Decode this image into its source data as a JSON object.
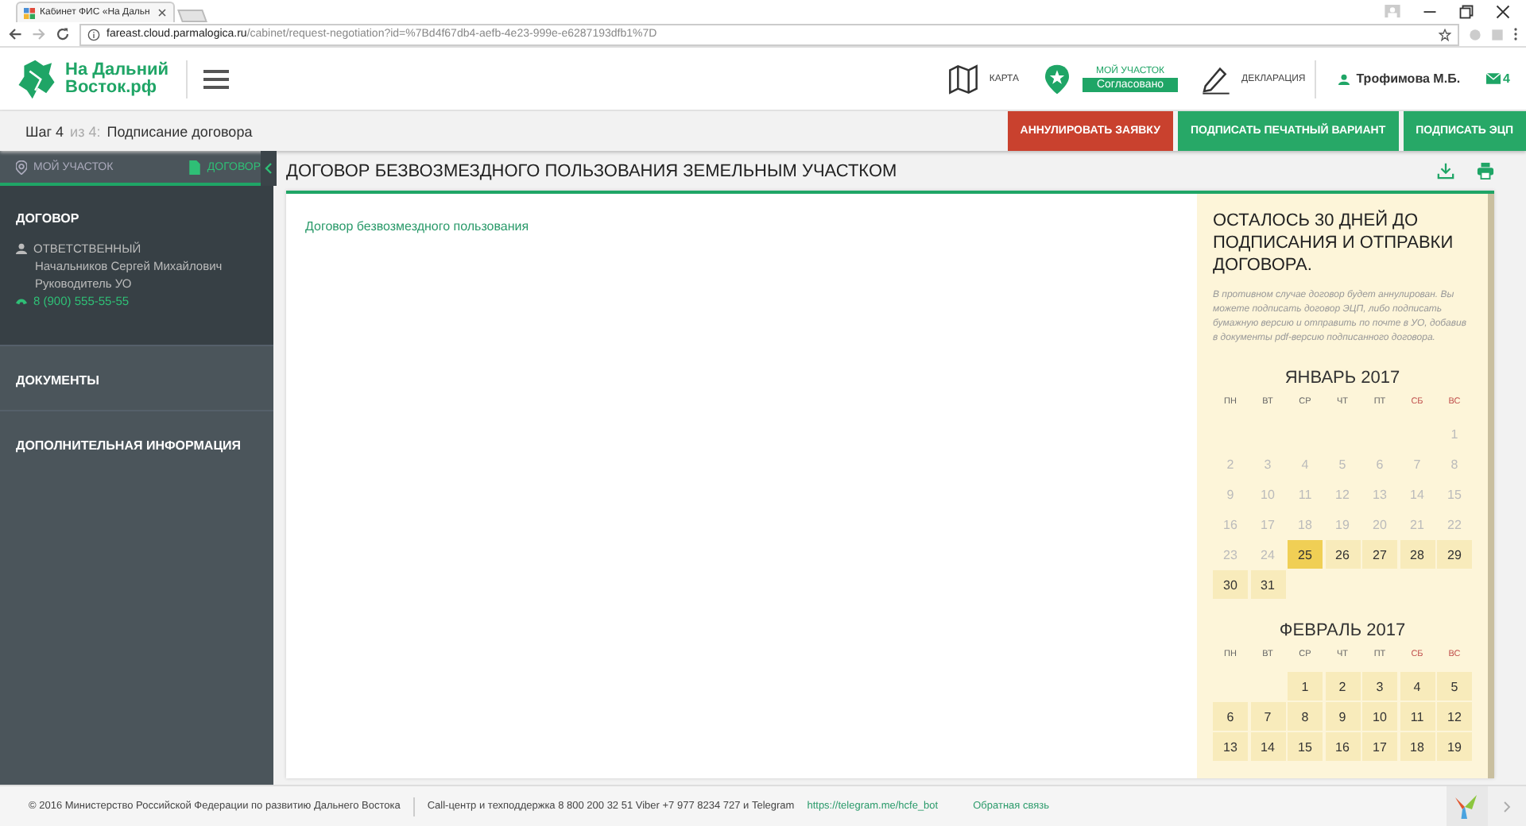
{
  "browser": {
    "tab_title": "Кабинет ФИС «На Дальн",
    "url_host": "fareast.cloud.parmalogica.ru",
    "url_path": "/cabinet/request-negotiation?id=%7Bd4f67db4-aefb-4e23-999e-e6287193dfb1%7D"
  },
  "header": {
    "logo_text": "На Дальний Восток.рф",
    "nav": [
      {
        "kind": "map",
        "label": "КАРТА"
      },
      {
        "kind": "plot",
        "label": "МОЙ УЧАСТОК",
        "badge": "Согласовано"
      },
      {
        "kind": "declaration",
        "label": "ДЕКЛАРАЦИЯ"
      }
    ],
    "user": "Трофимова М.Б.",
    "messages": "4"
  },
  "step": {
    "current": "Шаг 4",
    "of": "из 4:",
    "title": "Подписание договора"
  },
  "actions": [
    {
      "kind": "danger",
      "label": "АННУЛИРОВАТЬ ЗАЯВКУ"
    },
    {
      "kind": "primary",
      "label": "ПОДПИСАТЬ ПЕЧАТНЫЙ ВАРИАНТ"
    },
    {
      "kind": "primary",
      "label": "ПОДПИСАТЬ ЭЦП"
    }
  ],
  "sidebar": {
    "tabs": [
      {
        "kind": "plot",
        "label": "МОЙ УЧАСТОК",
        "selected": false
      },
      {
        "kind": "document",
        "label": "ДОГОВОР",
        "selected": true
      }
    ],
    "sections": [
      {
        "title": "ДОГОВОР",
        "expanded": true,
        "responsible_label": "ОТВЕТСТВЕННЫЙ",
        "person": "Начальников Сергей Михайлович",
        "role": "Руководитель УО",
        "phone": "8 (900) 555-55-55"
      },
      {
        "title": "ДОКУМЕНТЫ",
        "expanded": false
      },
      {
        "title": "ДОПОЛНИТЕЛЬНАЯ ИНФОРМАЦИЯ",
        "expanded": false
      }
    ]
  },
  "document": {
    "title": "ДОГОВОР БЕЗВОЗМЕЗДНОГО ПОЛЬЗОВАНИЯ ЗЕМЕЛЬНЫМ УЧАСТКОМ",
    "link": "Договор безвозмездного пользования"
  },
  "deadline": {
    "heading": "ОСТАЛОСЬ 30 ДНЕЙ ДО ПОДПИСАНИЯ И ОТПРАВКИ ДОГОВОРА.",
    "note": "В противном случае договор будет аннулирован. Вы можете подписать договор ЭЦП, либо подписать бумажную версию и отправить по почте в УО, добавив в документы pdf-версию подписанного договора.",
    "months": [
      {
        "title": "ЯНВАРЬ 2017",
        "weekdays": [
          {
            "label": "ПН",
            "weekend": false
          },
          {
            "label": "ВТ",
            "weekend": false
          },
          {
            "label": "СР",
            "weekend": false
          },
          {
            "label": "ЧТ",
            "weekend": false
          },
          {
            "label": "ПТ",
            "weekend": false
          },
          {
            "label": "СБ",
            "weekend": true
          },
          {
            "label": "ВС",
            "weekend": true
          }
        ],
        "cells": [
          {
            "kind": "blank"
          },
          {
            "kind": "blank"
          },
          {
            "kind": "blank"
          },
          {
            "kind": "blank"
          },
          {
            "kind": "blank"
          },
          {
            "kind": "blank"
          },
          {
            "kind": "day",
            "day": "1",
            "past": true,
            "today": false
          },
          {
            "kind": "day",
            "day": "2",
            "past": true,
            "today": false
          },
          {
            "kind": "day",
            "day": "3",
            "past": true,
            "today": false
          },
          {
            "kind": "day",
            "day": "4",
            "past": true,
            "today": false
          },
          {
            "kind": "day",
            "day": "5",
            "past": true,
            "today": false
          },
          {
            "kind": "day",
            "day": "6",
            "past": true,
            "today": false
          },
          {
            "kind": "day",
            "day": "7",
            "past": true,
            "today": false
          },
          {
            "kind": "day",
            "day": "8",
            "past": true,
            "today": false
          },
          {
            "kind": "day",
            "day": "9",
            "past": true,
            "today": false
          },
          {
            "kind": "day",
            "day": "10",
            "past": true,
            "today": false
          },
          {
            "kind": "day",
            "day": "11",
            "past": true,
            "today": false
          },
          {
            "kind": "day",
            "day": "12",
            "past": true,
            "today": false
          },
          {
            "kind": "day",
            "day": "13",
            "past": true,
            "today": false
          },
          {
            "kind": "day",
            "day": "14",
            "past": true,
            "today": false
          },
          {
            "kind": "day",
            "day": "15",
            "past": true,
            "today": false
          },
          {
            "kind": "day",
            "day": "16",
            "past": true,
            "today": false
          },
          {
            "kind": "day",
            "day": "17",
            "past": true,
            "today": false
          },
          {
            "kind": "day",
            "day": "18",
            "past": true,
            "today": false
          },
          {
            "kind": "day",
            "day": "19",
            "past": true,
            "today": false
          },
          {
            "kind": "day",
            "day": "20",
            "past": true,
            "today": false
          },
          {
            "kind": "day",
            "day": "21",
            "past": true,
            "today": false
          },
          {
            "kind": "day",
            "day": "22",
            "past": true,
            "today": false
          },
          {
            "kind": "day",
            "day": "23",
            "past": true,
            "today": false
          },
          {
            "kind": "day",
            "day": "24",
            "past": true,
            "today": false
          },
          {
            "kind": "day",
            "day": "25",
            "past": false,
            "today": true
          },
          {
            "kind": "day",
            "day": "26",
            "past": false,
            "today": false
          },
          {
            "kind": "day",
            "day": "27",
            "past": false,
            "today": false
          },
          {
            "kind": "day",
            "day": "28",
            "past": false,
            "today": false
          },
          {
            "kind": "day",
            "day": "29",
            "past": false,
            "today": false
          },
          {
            "kind": "day",
            "day": "30",
            "past": false,
            "today": false
          },
          {
            "kind": "day",
            "day": "31",
            "past": false,
            "today": false
          }
        ]
      },
      {
        "title": "ФЕВРАЛЬ 2017",
        "weekdays": [
          {
            "label": "ПН",
            "weekend": false
          },
          {
            "label": "ВТ",
            "weekend": false
          },
          {
            "label": "СР",
            "weekend": false
          },
          {
            "label": "ЧТ",
            "weekend": false
          },
          {
            "label": "ПТ",
            "weekend": false
          },
          {
            "label": "СБ",
            "weekend": true
          },
          {
            "label": "ВС",
            "weekend": true
          }
        ],
        "cells": [
          {
            "kind": "blank"
          },
          {
            "kind": "blank"
          },
          {
            "kind": "day",
            "day": "1",
            "past": false,
            "today": false
          },
          {
            "kind": "day",
            "day": "2",
            "past": false,
            "today": false
          },
          {
            "kind": "day",
            "day": "3",
            "past": false,
            "today": false
          },
          {
            "kind": "day",
            "day": "4",
            "past": false,
            "today": false
          },
          {
            "kind": "day",
            "day": "5",
            "past": false,
            "today": false
          },
          {
            "kind": "day",
            "day": "6",
            "past": false,
            "today": false
          },
          {
            "kind": "day",
            "day": "7",
            "past": false,
            "today": false
          },
          {
            "kind": "day",
            "day": "8",
            "past": false,
            "today": false
          },
          {
            "kind": "day",
            "day": "9",
            "past": false,
            "today": false
          },
          {
            "kind": "day",
            "day": "10",
            "past": false,
            "today": false
          },
          {
            "kind": "day",
            "day": "11",
            "past": false,
            "today": false
          },
          {
            "kind": "day",
            "day": "12",
            "past": false,
            "today": false
          },
          {
            "kind": "day",
            "day": "13",
            "past": false,
            "today": false
          },
          {
            "kind": "day",
            "day": "14",
            "past": false,
            "today": false
          },
          {
            "kind": "day",
            "day": "15",
            "past": false,
            "today": false
          },
          {
            "kind": "day",
            "day": "16",
            "past": false,
            "today": false
          },
          {
            "kind": "day",
            "day": "17",
            "past": false,
            "today": false
          },
          {
            "kind": "day",
            "day": "18",
            "past": false,
            "today": false
          },
          {
            "kind": "day",
            "day": "19",
            "past": false,
            "today": false
          }
        ]
      }
    ]
  },
  "footer": {
    "copyright": "© 2016 Министерство Российской Федерации по развитию Дальнего Востока",
    "support": "Call-центр и техподдержка 8 800 200 32 51   Viber +7 977 8234 727 и Telegram",
    "telegram_link": "https://telegram.me/hcfe_bot",
    "feedback_link": "Обратная связь"
  }
}
